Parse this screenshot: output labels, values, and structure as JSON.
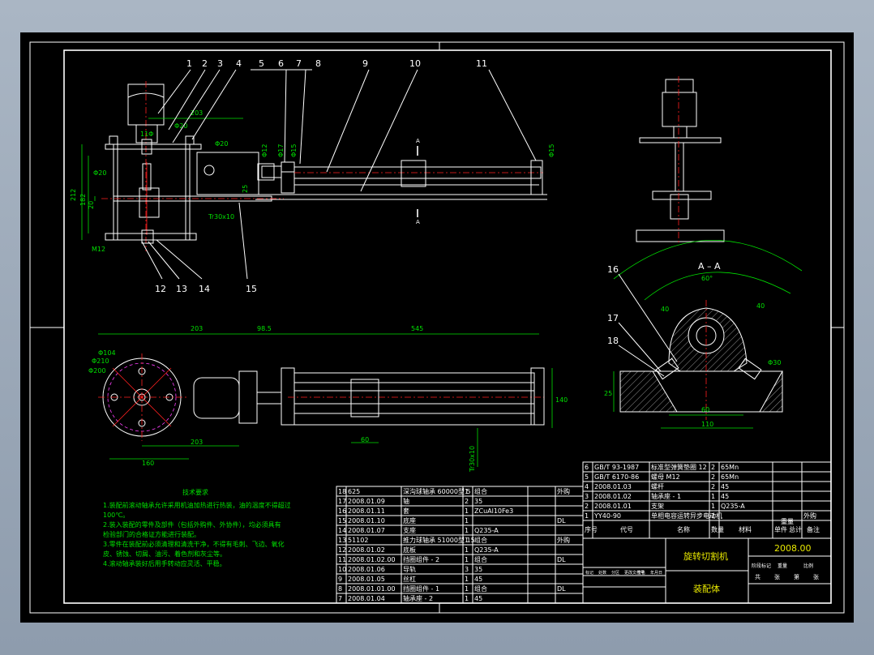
{
  "part_numbers": [
    "1",
    "2",
    "3",
    "4",
    "5",
    "6",
    "7",
    "8",
    "9",
    "10",
    "11",
    "12",
    "13",
    "14",
    "15",
    "16",
    "17",
    "18"
  ],
  "section_label": "A – A",
  "section_marks": [
    "A",
    "A"
  ],
  "top_view_dims": {
    "d203": "203",
    "d20": "Φ20",
    "d20b": "Φ20",
    "d212": "212",
    "d182": "182",
    "d20v": "20",
    "m12": "M12",
    "tr": "Tr30x10",
    "d12": "Φ12",
    "d17": "Φ17",
    "d15": "Φ15",
    "d15b": "Φ15",
    "d20c": "Φ20",
    "d25": "25",
    "d11": "11Φ"
  },
  "plan_dims": {
    "d203": "203",
    "d985": "98.5",
    "d545": "545",
    "d104": "Φ104",
    "d210": "Φ210",
    "d200": "Φ200",
    "d140": "140",
    "d160": "160",
    "d203b": "203",
    "d60": "60",
    "tr": "Tr30x10"
  },
  "section_dims": {
    "a60top": "60°",
    "a40a": "40",
    "a40b": "40",
    "a30": "Φ30",
    "d25": "25",
    "d60": "60",
    "d110": "110"
  },
  "notes": {
    "title": "技术要求",
    "lines": [
      "1.装配前滚动轴承允许采用机油加热进行热装，油的温度不得超过",
      "100℃。",
      "2.装入装配的零件及部件（包括外购件、外协件），均必须具有",
      "检验部门的合格证方能进行装配。",
      "3.零件在装配前必须清理和清洗干净，不得有毛刺、飞边、氧化",
      "皮、锈蚀、切屑、油污、着色剂和灰尘等。",
      "4.滚动轴承装好后用手转动应灵活、平稳。"
    ]
  },
  "bom_left": [
    [
      "18",
      "625",
      "深沟球轴承 60000型 5",
      "1",
      "组合",
      "",
      "外购"
    ],
    [
      "17",
      "2008.01.09",
      "轴",
      "2",
      "35",
      "",
      ""
    ],
    [
      "16",
      "2008.01.11",
      "套",
      "1",
      "ZCuAl10Fe3",
      "",
      ""
    ],
    [
      "15",
      "2008.01.10",
      "底座",
      "1",
      "",
      "",
      "DL"
    ],
    [
      "14",
      "2008.01.07",
      "支座",
      "1",
      "Q235-A",
      "",
      ""
    ],
    [
      "13",
      "51102",
      "推力球轴承 51000型 15",
      "1",
      "组合",
      "",
      "外购"
    ],
    [
      "12",
      "2008.01.02",
      "底板",
      "1",
      "Q235-A",
      "",
      ""
    ],
    [
      "11",
      "2008.01.02.00",
      "挡圈组件 - 2",
      "1",
      "组合",
      "",
      "DL"
    ],
    [
      "10",
      "2008.01.06",
      "导轨",
      "3",
      "35",
      "",
      ""
    ],
    [
      "9",
      "2008.01.05",
      "丝杠",
      "1",
      "45",
      "",
      ""
    ],
    [
      "8",
      "2008.01.01.00",
      "挡圈组件 - 1",
      "1",
      "组合",
      "",
      "DL"
    ],
    [
      "7",
      "2008.01.04",
      "轴承座 - 2",
      "1",
      "45",
      "",
      ""
    ]
  ],
  "bom_right": [
    [
      "6",
      "GB/T 93-1987",
      "标准型弹簧垫圈 12",
      "2",
      "65Mn",
      "",
      ""
    ],
    [
      "5",
      "GB/T 6170-86",
      "螺母 M12",
      "2",
      "65Mn",
      "",
      ""
    ],
    [
      "4",
      "2008.01.03",
      "螺杆",
      "2",
      "45",
      "",
      ""
    ],
    [
      "3",
      "2008.01.02",
      "轴承座 - 1",
      "1",
      "45",
      "",
      ""
    ],
    [
      "2",
      "2008.01.01",
      "支架",
      "1",
      "Q235-A",
      "",
      ""
    ],
    [
      "1",
      "YY40-90",
      "单相电容运转异步电动机",
      "1",
      "",
      "",
      "外购"
    ]
  ],
  "bom_header": [
    "序号",
    "代号",
    "名称",
    "数量",
    "材料",
    "单件",
    "总计",
    "备注"
  ],
  "bom_header_sub": "重量",
  "title_block": {
    "product": "旋转切割机",
    "drawing": "装配体",
    "number": "2008.00",
    "small_row": [
      "标记",
      "处数",
      "分区",
      "更改文件号",
      "签名",
      "年月日"
    ],
    "small_row2": [
      "阶段标记",
      "重量",
      "比例"
    ],
    "sheet_row": [
      "共",
      "张",
      "第",
      "张"
    ]
  },
  "colors": {
    "frame": "#ffffff",
    "dim": "#00e000",
    "center": "#ff2020",
    "text": "#ffffff",
    "note": "#00e000"
  }
}
